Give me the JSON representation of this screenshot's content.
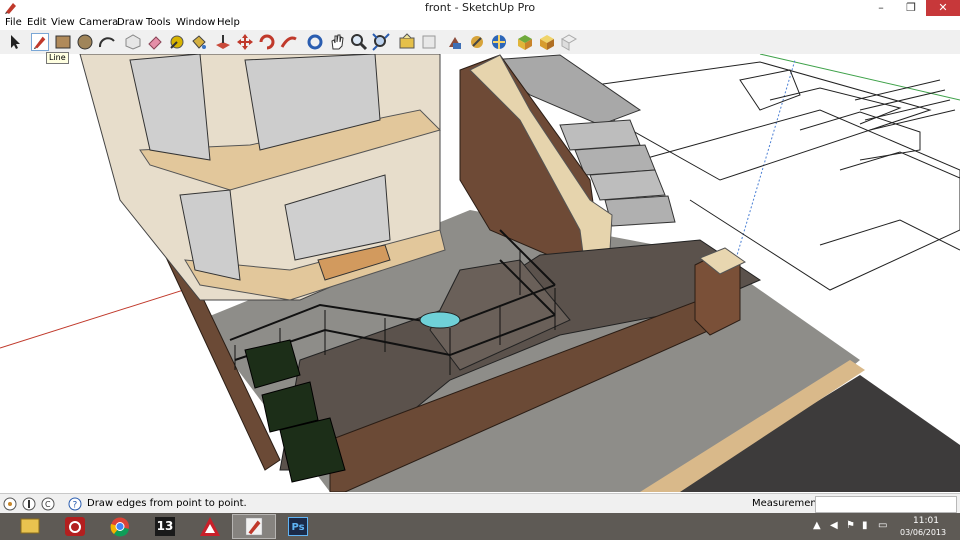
{
  "window": {
    "title": "front - SketchUp Pro",
    "minimize": "–",
    "maximize": "❐",
    "close": "✕"
  },
  "menu": [
    "File",
    "Edit",
    "View",
    "Camera",
    "Draw",
    "Tools",
    "Window",
    "Help"
  ],
  "toolbar": {
    "tools": [
      "select-icon",
      "pencil-line-icon",
      "rectangle-icon",
      "circle-icon",
      "arc-icon",
      "make-component-icon",
      "eraser-icon",
      "tape-measure-icon",
      "paint-bucket-icon",
      "push-pull-icon",
      "move-icon",
      "rotate-icon",
      "follow-me-icon",
      "orbit-icon",
      "pan-icon",
      "zoom-icon",
      "zoom-extents-icon",
      "get-models-icon",
      "share-model-icon",
      "components-icon",
      "styles-icon",
      "3d-warehouse-icon",
      "extension-icon",
      "layout-icon",
      "send-icon"
    ],
    "tooltip": "Line"
  },
  "status": {
    "hint": "Draw edges from point to point.",
    "measurements_label": "Measurements",
    "measurements_value": ""
  },
  "taskbar": {
    "apps": [
      "file-explorer-icon",
      "power-icon",
      "chrome-icon",
      "app-13-icon",
      "autocad-icon",
      "sketchup-icon",
      "photoshop-icon"
    ],
    "app13_label": "13",
    "ps_label": "Ps",
    "time": "11:01",
    "date": "03/06/2013"
  },
  "colors": {
    "sky": "#ffffff",
    "wall": "#e8dfcf",
    "brick": "#6b4a36",
    "deck": "#5e5650",
    "paving": "#8c8c88",
    "road": "#3c3a3a"
  }
}
